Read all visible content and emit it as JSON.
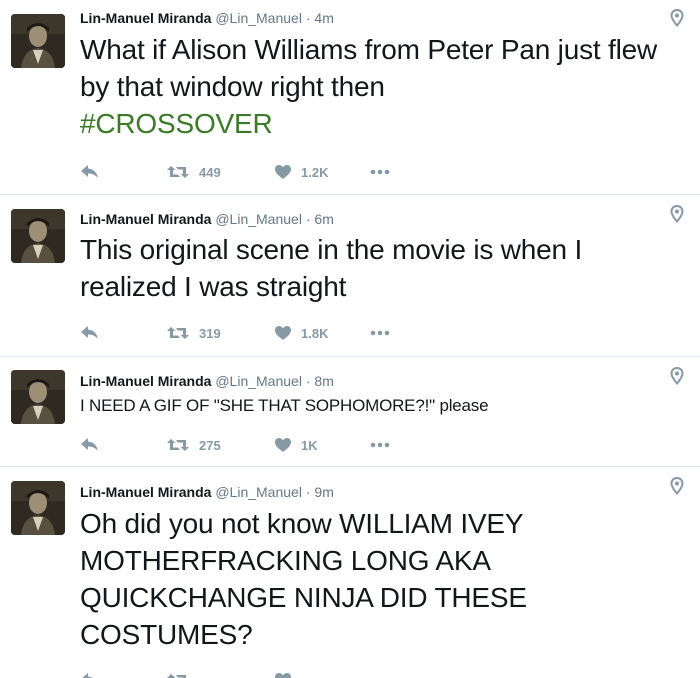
{
  "tweets": [
    {
      "name": "Lin-Manuel Miranda",
      "handle": "@Lin_Manuel",
      "separator": "·",
      "time": "4m",
      "text_plain": "What if Alison Williams from Peter Pan just flew by that window right then",
      "hashtag": "#CROSSOVER",
      "retweets": "449",
      "likes": "1.2K"
    },
    {
      "name": "Lin-Manuel Miranda",
      "handle": "@Lin_Manuel",
      "separator": "·",
      "time": "6m",
      "text_plain": "This original scene in the movie is when I realized I was straight",
      "retweets": "319",
      "likes": "1.8K"
    },
    {
      "name": "Lin-Manuel Miranda",
      "handle": "@Lin_Manuel",
      "separator": "·",
      "time": "8m",
      "text_plain": "I NEED A GIF OF \"SHE THAT SOPHOMORE?!\" please",
      "retweets": "275",
      "likes": "1K"
    },
    {
      "name": "Lin-Manuel Miranda",
      "handle": "@Lin_Manuel",
      "separator": "·",
      "time": "9m",
      "text_plain": "Oh did you not know WILLIAM IVEY MOTHERFRACKING LONG AKA QUICKCHANGE NINJA DID THESE COSTUMES?"
    }
  ],
  "icons": {
    "reply": "reply-icon",
    "retweet": "retweet-icon",
    "like": "heart-icon",
    "more": "more-dots-icon",
    "location": "location-pin-icon"
  },
  "colors": {
    "text": "#14171a",
    "meta": "#657786",
    "action": "#8899a6",
    "hashtag": "#3b7a26",
    "divider": "#e1e8ed"
  }
}
